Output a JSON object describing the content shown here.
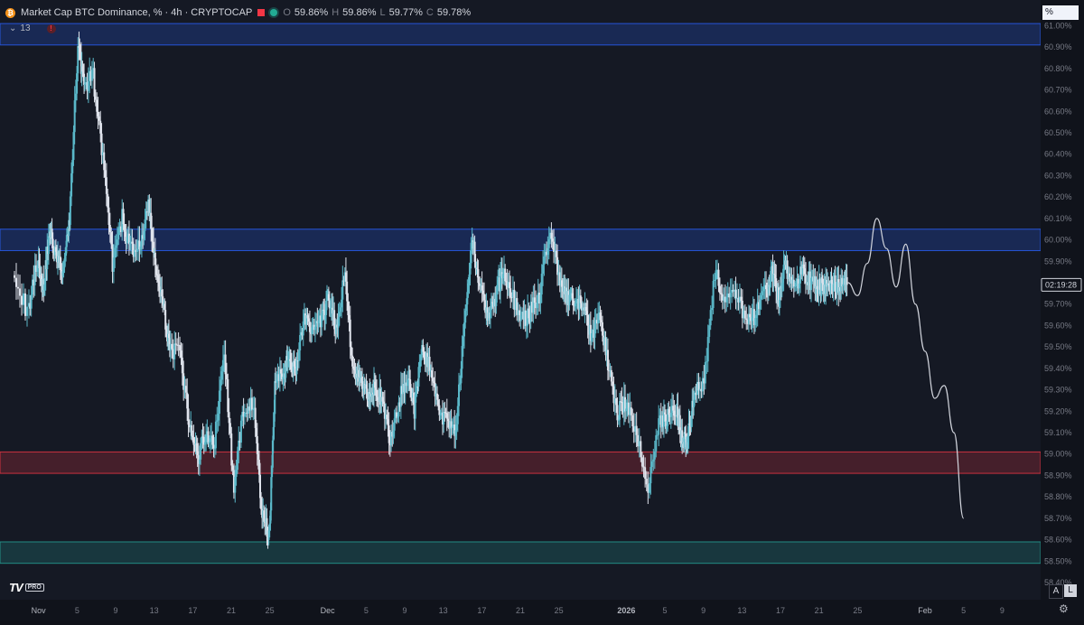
{
  "header": {
    "symbol_title": "Market Cap BTC Dominance, % · 4h · CRYPTOCAP",
    "ohlc": [
      {
        "key": "O",
        "value": "59.86%"
      },
      {
        "key": "H",
        "value": "59.86%"
      },
      {
        "key": "L",
        "value": "59.77%"
      },
      {
        "key": "C",
        "value": "59.78%"
      }
    ],
    "indicator_count": "13",
    "error_badge": "!"
  },
  "unit_label": "%",
  "logo_pro": "PRO",
  "buttons": {
    "auto": "A",
    "log": "L"
  },
  "colors": {
    "background": "#151924",
    "candle": "#dfe3ec",
    "candle_accent": "#5ab8c9",
    "resistance_zone": "#2962ff",
    "support_zone": "#f23645",
    "demand_zone": "#26a69a",
    "projection": "#d1d4dc"
  },
  "chart_data": {
    "type": "line",
    "title": "Market Cap BTC Dominance, % · 4h · CRYPTOCAP",
    "xlabel": "",
    "ylabel": "",
    "ylim": [
      58.32,
      61.12
    ],
    "y_ticks": [
      "61.00%",
      "60.90%",
      "60.80%",
      "60.70%",
      "60.60%",
      "60.50%",
      "60.40%",
      "60.30%",
      "60.20%",
      "60.10%",
      "60.00%",
      "59.90%",
      "59.80%",
      "59.70%",
      "59.60%",
      "59.50%",
      "59.40%",
      "59.30%",
      "59.20%",
      "59.10%",
      "59.00%",
      "58.90%",
      "58.80%",
      "58.70%",
      "58.60%",
      "58.50%",
      "58.40%"
    ],
    "y_tick_values": [
      61.0,
      60.9,
      60.8,
      60.7,
      60.6,
      60.5,
      60.4,
      60.3,
      60.2,
      60.1,
      60.0,
      59.9,
      59.8,
      59.7,
      59.6,
      59.5,
      59.4,
      59.3,
      59.2,
      59.1,
      59.0,
      58.9,
      58.8,
      58.7,
      58.6,
      58.5,
      58.4
    ],
    "x_ticks": [
      {
        "label": "Nov",
        "day": 1
      },
      {
        "label": "5",
        "day": 5
      },
      {
        "label": "9",
        "day": 9
      },
      {
        "label": "13",
        "day": 13
      },
      {
        "label": "17",
        "day": 17
      },
      {
        "label": "21",
        "day": 21
      },
      {
        "label": "25",
        "day": 25
      },
      {
        "label": "Dec",
        "day": 31
      },
      {
        "label": "5",
        "day": 35
      },
      {
        "label": "9",
        "day": 39
      },
      {
        "label": "13",
        "day": 43
      },
      {
        "label": "17",
        "day": 47
      },
      {
        "label": "21",
        "day": 51
      },
      {
        "label": "25",
        "day": 55
      },
      {
        "label": "2026",
        "day": 62
      },
      {
        "label": "5",
        "day": 66
      },
      {
        "label": "9",
        "day": 70
      },
      {
        "label": "13",
        "day": 74
      },
      {
        "label": "17",
        "day": 78
      },
      {
        "label": "21",
        "day": 82
      },
      {
        "label": "25",
        "day": 86
      },
      {
        "label": "Feb",
        "day": 93
      },
      {
        "label": "5",
        "day": 97
      },
      {
        "label": "9",
        "day": 101
      }
    ],
    "price_label": {
      "value": 59.79,
      "text": "02:19:28"
    },
    "zones": [
      {
        "kind": "resistance",
        "from": 60.91,
        "to": 61.01
      },
      {
        "kind": "resistance",
        "from": 59.95,
        "to": 60.05
      },
      {
        "kind": "support",
        "from": 58.91,
        "to": 59.01
      },
      {
        "kind": "demand",
        "from": 58.49,
        "to": 58.59
      }
    ],
    "series": [
      {
        "type": "candlestick_trace",
        "x_day": [
          -1.5,
          0,
          1,
          1.6,
          2.2,
          3,
          3.7,
          4.3,
          5.2,
          5.8,
          6.8,
          7.8,
          8.8,
          9.8,
          10.6,
          11.6,
          12.5,
          13.2,
          14,
          14.7,
          15.8,
          16.8,
          17.6,
          18.5,
          19.4,
          20.4,
          21.4,
          22.4,
          23.4,
          24.2,
          25,
          25.6,
          26.5,
          27.1,
          27.8,
          28.7,
          29.6,
          30.5,
          31.2,
          32,
          32.9,
          33.8,
          34.5,
          35.2,
          35.9,
          36.7,
          37.6,
          38.5,
          39.4,
          40.1,
          40.8,
          41.7,
          42.6,
          43.5,
          44.4,
          45.3,
          46.1,
          46.8,
          47.7,
          48.5,
          49.2,
          50.1,
          51.2,
          52.1,
          53.1,
          54.1,
          55.1,
          55.9,
          56.7,
          57.6,
          58.4,
          59.3,
          60.2,
          61.2,
          62.1,
          63.2,
          64.4,
          65.5,
          66.3,
          67.2,
          67.8,
          68.4,
          69.1,
          70.2,
          71.3,
          72.4,
          73.5,
          74.6,
          75.5,
          76.5,
          77.2,
          77.9,
          78.6,
          79.5,
          80.4,
          81.3,
          82.1,
          82.7,
          83.5,
          84.2,
          85
        ],
        "values": [
          59.88,
          59.65,
          59.92,
          59.76,
          60.05,
          59.9,
          59.86,
          60.1,
          60.92,
          60.72,
          60.76,
          60.38,
          59.88,
          60.1,
          59.96,
          59.96,
          60.15,
          59.89,
          59.68,
          59.5,
          59.46,
          59.12,
          58.98,
          59.1,
          59.06,
          59.48,
          58.82,
          59.22,
          59.24,
          58.75,
          58.6,
          59.32,
          59.38,
          59.45,
          59.4,
          59.65,
          59.56,
          59.62,
          59.72,
          59.58,
          59.84,
          59.36,
          59.36,
          59.28,
          59.32,
          59.24,
          59.06,
          59.24,
          59.38,
          59.2,
          59.48,
          59.42,
          59.2,
          59.16,
          59.12,
          59.58,
          60.0,
          59.82,
          59.64,
          59.72,
          59.85,
          59.77,
          59.62,
          59.66,
          59.74,
          60.04,
          59.84,
          59.72,
          59.7,
          59.7,
          59.54,
          59.66,
          59.42,
          59.2,
          59.24,
          59.08,
          58.85,
          59.15,
          59.16,
          59.22,
          59.09,
          59.05,
          59.29,
          59.35,
          59.85,
          59.72,
          59.73,
          59.64,
          59.64,
          59.75,
          59.85,
          59.72,
          59.88,
          59.76,
          59.86,
          59.8,
          59.78,
          59.78,
          59.8,
          59.78,
          59.79
        ]
      },
      {
        "type": "projection",
        "x_day": [
          85,
          86,
          87,
          88,
          89,
          90,
          91,
          92,
          93,
          94,
          95,
          96,
          97
        ],
        "values": [
          59.8,
          59.74,
          59.89,
          60.1,
          59.96,
          59.78,
          59.98,
          59.7,
          59.48,
          59.26,
          59.32,
          59.1,
          58.7
        ]
      }
    ]
  }
}
